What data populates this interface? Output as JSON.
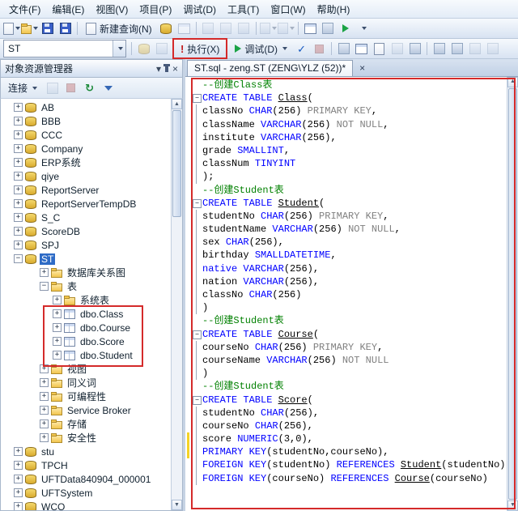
{
  "icons": {
    "close": "×",
    "caret": "▾",
    "up_arrow": "▲",
    "down_arrow": "▼",
    "execute_bang": "!",
    "parse_check": "✓",
    "refresh": "↻",
    "plus": "+",
    "minus": "−"
  },
  "menubar": {
    "items": [
      {
        "id": "file",
        "label": "文件(F)"
      },
      {
        "id": "edit",
        "label": "编辑(E)"
      },
      {
        "id": "view",
        "label": "视图(V)"
      },
      {
        "id": "project",
        "label": "项目(P)"
      },
      {
        "id": "debug",
        "label": "调试(D)"
      },
      {
        "id": "tools",
        "label": "工具(T)"
      },
      {
        "id": "window",
        "label": "窗口(W)"
      },
      {
        "id": "help",
        "label": "帮助(H)"
      }
    ]
  },
  "toolbar_main": {
    "new_query_label": "新建查询(N)"
  },
  "toolbar_sql": {
    "database_combo_value": "ST",
    "execute_label": "执行(X)",
    "debug_label": "调试(D)"
  },
  "object_explorer": {
    "title": "对象资源管理器",
    "connect_label": "连接",
    "tree": [
      {
        "label": "AB",
        "icon": "db",
        "depth": 0,
        "expand": "plus"
      },
      {
        "label": "BBB",
        "icon": "db",
        "depth": 0,
        "expand": "plus"
      },
      {
        "label": "CCC",
        "icon": "db",
        "depth": 0,
        "expand": "plus"
      },
      {
        "label": "Company",
        "icon": "db",
        "depth": 0,
        "expand": "plus"
      },
      {
        "label": "ERP系统",
        "icon": "db",
        "depth": 0,
        "expand": "plus"
      },
      {
        "label": "qiye",
        "icon": "db",
        "depth": 0,
        "expand": "plus"
      },
      {
        "label": "ReportServer",
        "icon": "db",
        "depth": 0,
        "expand": "plus"
      },
      {
        "label": "ReportServerTempDB",
        "icon": "db",
        "depth": 0,
        "expand": "plus"
      },
      {
        "label": "S_C",
        "icon": "db",
        "depth": 0,
        "expand": "plus"
      },
      {
        "label": "ScoreDB",
        "icon": "db",
        "depth": 0,
        "expand": "plus"
      },
      {
        "label": "SPJ",
        "icon": "db",
        "depth": 0,
        "expand": "plus"
      },
      {
        "label": "ST",
        "icon": "db",
        "depth": 0,
        "expand": "minus",
        "selected": true
      },
      {
        "label": "数据库关系图",
        "icon": "folder",
        "depth": 2,
        "expand": "plus"
      },
      {
        "label": "表",
        "icon": "folder",
        "depth": 2,
        "expand": "minus"
      },
      {
        "label": "系统表",
        "icon": "folder",
        "depth": 3,
        "expand": "plus"
      },
      {
        "label": "dbo.Class",
        "icon": "table",
        "depth": 3,
        "expand": "plus"
      },
      {
        "label": "dbo.Course",
        "icon": "table",
        "depth": 3,
        "expand": "plus"
      },
      {
        "label": "dbo.Score",
        "icon": "table",
        "depth": 3,
        "expand": "plus"
      },
      {
        "label": "dbo.Student",
        "icon": "table",
        "depth": 3,
        "expand": "plus"
      },
      {
        "label": "视图",
        "icon": "folder",
        "depth": 2,
        "expand": "plus"
      },
      {
        "label": "同义词",
        "icon": "folder",
        "depth": 2,
        "expand": "plus"
      },
      {
        "label": "可编程性",
        "icon": "folder",
        "depth": 2,
        "expand": "plus"
      },
      {
        "label": "Service Broker",
        "icon": "folder",
        "depth": 2,
        "expand": "plus"
      },
      {
        "label": "存储",
        "icon": "folder",
        "depth": 2,
        "expand": "plus"
      },
      {
        "label": "安全性",
        "icon": "folder",
        "depth": 2,
        "expand": "plus"
      },
      {
        "label": "stu",
        "icon": "db",
        "depth": 0,
        "expand": "plus"
      },
      {
        "label": "TPCH",
        "icon": "db",
        "depth": 0,
        "expand": "plus"
      },
      {
        "label": "UFTData840904_000001",
        "icon": "db",
        "depth": 0,
        "expand": "plus"
      },
      {
        "label": "UFTSystem",
        "icon": "db",
        "depth": 0,
        "expand": "plus"
      },
      {
        "label": "WCO",
        "icon": "db",
        "depth": 0,
        "expand": "plus"
      }
    ]
  },
  "editor": {
    "tab_title": "ST.sql - zeng.ST (ZENG\\YLZ (52))*",
    "lines": [
      {
        "s": [
          [
            "c",
            "--创建Class表"
          ]
        ]
      },
      {
        "f": "s",
        "s": [
          [
            "k",
            "CREATE TABLE "
          ],
          [
            "u",
            "Class"
          ],
          [
            "d",
            "("
          ]
        ]
      },
      {
        "f": "m",
        "s": [
          [
            "d",
            "classNo "
          ],
          [
            "k",
            "CHAR"
          ],
          [
            "d",
            "(256) "
          ],
          [
            "g",
            "PRIMARY KEY"
          ],
          [
            "d",
            ","
          ]
        ]
      },
      {
        "f": "m",
        "s": [
          [
            "d",
            "className "
          ],
          [
            "k",
            "VARCHAR"
          ],
          [
            "d",
            "(256) "
          ],
          [
            "g",
            "NOT NULL"
          ],
          [
            "d",
            ","
          ]
        ]
      },
      {
        "f": "m",
        "s": [
          [
            "d",
            "institute "
          ],
          [
            "k",
            "VARCHAR"
          ],
          [
            "d",
            "(256),"
          ]
        ]
      },
      {
        "f": "m",
        "s": [
          [
            "d",
            "grade "
          ],
          [
            "k",
            "SMALLINT"
          ],
          [
            "d",
            ","
          ]
        ]
      },
      {
        "f": "m",
        "s": [
          [
            "d",
            "classNum "
          ],
          [
            "k",
            "TINYINT"
          ]
        ]
      },
      {
        "f": "m",
        "s": [
          [
            "d",
            ");"
          ]
        ]
      },
      {
        "s": [
          [
            "c",
            "--创建Student表"
          ]
        ]
      },
      {
        "f": "s",
        "s": [
          [
            "k",
            "CREATE TABLE "
          ],
          [
            "u",
            "Student"
          ],
          [
            "d",
            "("
          ]
        ]
      },
      {
        "f": "m",
        "s": [
          [
            "d",
            "studentNo "
          ],
          [
            "k",
            "CHAR"
          ],
          [
            "d",
            "(256) "
          ],
          [
            "g",
            "PRIMARY KEY"
          ],
          [
            "d",
            ","
          ]
        ]
      },
      {
        "f": "m",
        "s": [
          [
            "d",
            "studentName "
          ],
          [
            "k",
            "VARCHAR"
          ],
          [
            "d",
            "(256) "
          ],
          [
            "g",
            "NOT NULL"
          ],
          [
            "d",
            ","
          ]
        ]
      },
      {
        "f": "m",
        "s": [
          [
            "d",
            "sex "
          ],
          [
            "k",
            "CHAR"
          ],
          [
            "d",
            "(256),"
          ]
        ]
      },
      {
        "f": "m",
        "s": [
          [
            "d",
            "birthday "
          ],
          [
            "k",
            "SMALLDATETIME"
          ],
          [
            "d",
            ","
          ]
        ]
      },
      {
        "f": "m",
        "s": [
          [
            "k",
            "native "
          ],
          [
            "k",
            "VARCHAR"
          ],
          [
            "d",
            "(256),"
          ]
        ]
      },
      {
        "f": "m",
        "s": [
          [
            "d",
            "nation "
          ],
          [
            "k",
            "VARCHAR"
          ],
          [
            "d",
            "(256),"
          ]
        ]
      },
      {
        "f": "m",
        "s": [
          [
            "d",
            "classNo "
          ],
          [
            "k",
            "CHAR"
          ],
          [
            "d",
            "(256)"
          ]
        ]
      },
      {
        "f": "m",
        "s": [
          [
            "d",
            ")"
          ]
        ]
      },
      {
        "s": [
          [
            "c",
            "--创建Student表"
          ]
        ]
      },
      {
        "f": "s",
        "s": [
          [
            "k",
            "CREATE TABLE "
          ],
          [
            "u",
            "Course"
          ],
          [
            "d",
            "("
          ]
        ]
      },
      {
        "f": "m",
        "s": [
          [
            "d",
            "courseNo "
          ],
          [
            "k",
            "CHAR"
          ],
          [
            "d",
            "(256) "
          ],
          [
            "g",
            "PRIMARY KEY"
          ],
          [
            "d",
            ","
          ]
        ]
      },
      {
        "f": "m",
        "s": [
          [
            "d",
            "courseName "
          ],
          [
            "k",
            "VARCHAR"
          ],
          [
            "d",
            "(256) "
          ],
          [
            "g",
            "NOT NULL"
          ]
        ]
      },
      {
        "f": "m",
        "s": [
          [
            "d",
            ")"
          ]
        ]
      },
      {
        "s": [
          [
            "c",
            "--创建Student表"
          ]
        ]
      },
      {
        "f": "s",
        "s": [
          [
            "k",
            "CREATE TABLE "
          ],
          [
            "u",
            "Score"
          ],
          [
            "d",
            "("
          ]
        ]
      },
      {
        "f": "m",
        "s": [
          [
            "d",
            "studentNo "
          ],
          [
            "k",
            "CHAR"
          ],
          [
            "d",
            "(256),"
          ]
        ]
      },
      {
        "f": "m",
        "s": [
          [
            "d",
            "courseNo "
          ],
          [
            "k",
            "CHAR"
          ],
          [
            "d",
            "(256),"
          ]
        ]
      },
      {
        "f": "m",
        "t": 1,
        "s": [
          [
            "d",
            "score "
          ],
          [
            "k",
            "NUMERIC"
          ],
          [
            "d",
            "(3,0),"
          ]
        ]
      },
      {
        "f": "m",
        "t": 1,
        "s": [
          [
            "k",
            "PRIMARY KEY"
          ],
          [
            "d",
            "(studentNo,courseNo),"
          ]
        ]
      },
      {
        "f": "m",
        "s": [
          [
            "k",
            "FOREIGN KEY"
          ],
          [
            "d",
            "(studentNo) "
          ],
          [
            "k",
            "REFERENCES"
          ],
          [
            "d",
            " "
          ],
          [
            "u",
            "Student"
          ],
          [
            "d",
            "(studentNo),"
          ]
        ]
      },
      {
        "f": "m",
        "s": [
          [
            "k",
            "FOREIGN KEY"
          ],
          [
            "d",
            "(courseNo) "
          ],
          [
            "k",
            "REFERENCES"
          ],
          [
            "d",
            " "
          ],
          [
            "u",
            "Course"
          ],
          [
            "d",
            "(courseNo)"
          ]
        ]
      }
    ]
  }
}
